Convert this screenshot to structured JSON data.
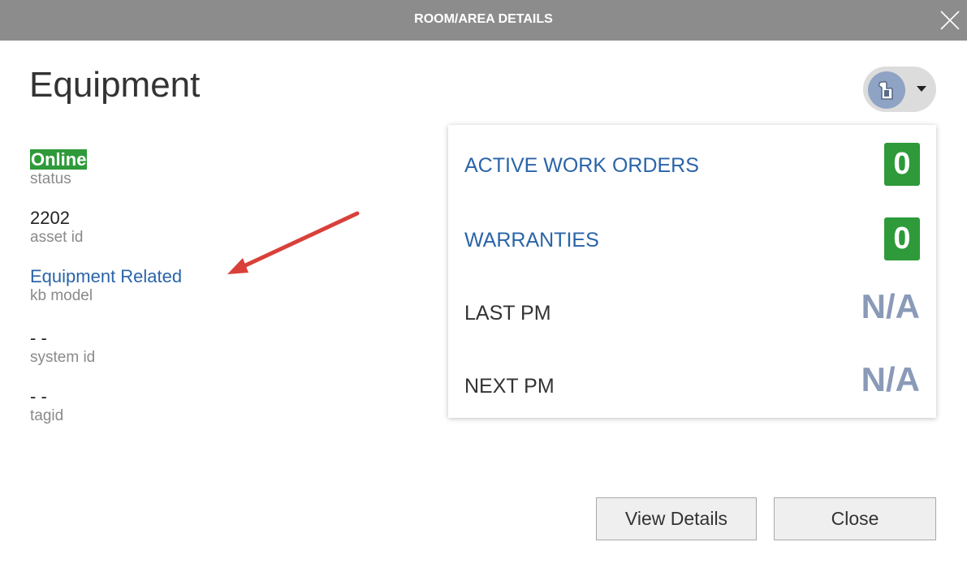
{
  "dialog": {
    "title": "ROOM/AREA DETAILS"
  },
  "page": {
    "title": "Equipment"
  },
  "fields": [
    {
      "value": "Online",
      "label": "status"
    },
    {
      "value": "2202",
      "label": "asset id"
    },
    {
      "value": "Equipment Related",
      "label": "kb model"
    },
    {
      "value": "- -",
      "label": "system id"
    },
    {
      "value": "- -",
      "label": "tagid"
    }
  ],
  "summary": {
    "active_work_orders": {
      "label": "ACTIVE WORK ORDERS",
      "value": "0"
    },
    "warranties": {
      "label": "WARRANTIES",
      "value": "0"
    },
    "last_pm": {
      "label": "LAST PM",
      "value": "N/A"
    },
    "next_pm": {
      "label": "NEXT PM",
      "value": "N/A"
    }
  },
  "buttons": {
    "view_details": "View Details",
    "close": "Close"
  },
  "icons": {
    "action_menu": "wrench-hand-icon",
    "close": "close-icon",
    "dropdown": "caret-down-icon"
  },
  "colors": {
    "titlebar": "#8c8c8c",
    "status_online": "#2e9a3a",
    "badge": "#2e9a3a",
    "link": "#2a64a8",
    "na": "#8a9ab8",
    "annotation_arrow": "#d9403a"
  }
}
